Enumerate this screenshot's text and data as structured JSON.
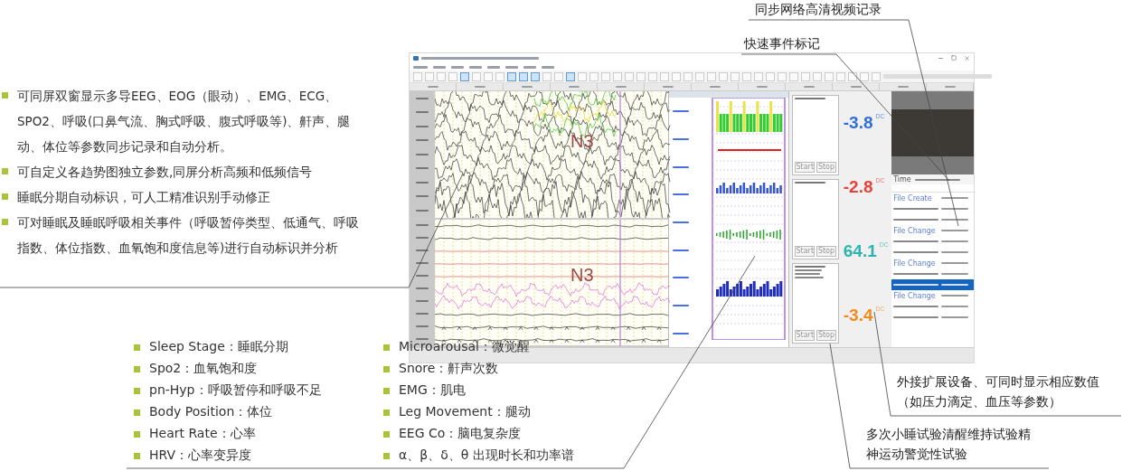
{
  "intro_notes": [
    "可同屏双窗显示多导EEG、EOG（眼动）、EMG、ECG、SPO2、呼吸(口鼻气流、胸式呼吸、腹式呼吸等)、鼾声、腿动、体位等参数同步记录和自动分析。",
    "可自定义各趋势图独立参数,同屏分析高频和低频信号",
    "睡眠分期自动标识，可人工精准识别手动修正",
    "可对睡眠及睡眠呼吸相关事件（呼吸暂停类型、低通气、呼吸指数、体位指数、血氧饱和度信息等)进行自动标识并分析"
  ],
  "software_window": {
    "stage_labels": [
      "N3",
      "N3"
    ],
    "event_boxes": [
      {
        "buttons": [
          "Start",
          "Stop"
        ]
      },
      {
        "buttons": [
          "Start",
          "Stop"
        ]
      },
      {
        "buttons": [
          "Start",
          "Stop"
        ]
      }
    ],
    "readings": [
      {
        "value": "-3.8",
        "unit": "DC",
        "color": "#2f6fd6"
      },
      {
        "value": "-2.8",
        "unit": "DC",
        "color": "#e8413c"
      },
      {
        "value": "64.1",
        "unit": "DC",
        "color": "#2bb5b0"
      },
      {
        "value": "-3.4",
        "unit": "DC",
        "color": "#f28a1e"
      }
    ],
    "video_panel": {
      "time_label": "Time"
    },
    "event_list": {
      "rows": [
        {
          "kind": "file",
          "label": "File Create",
          "selected": false
        },
        {
          "kind": "other",
          "selected": false
        },
        {
          "kind": "other",
          "selected": false
        },
        {
          "kind": "file",
          "label": "File Change",
          "selected": false
        },
        {
          "kind": "other",
          "selected": false
        },
        {
          "kind": "other",
          "selected": false
        },
        {
          "kind": "file",
          "label": "File Change",
          "selected": false
        },
        {
          "kind": "other",
          "selected": false
        },
        {
          "kind": "other",
          "selected": true
        },
        {
          "kind": "file",
          "label": "File Change",
          "selected": false
        },
        {
          "kind": "other",
          "selected": false
        },
        {
          "kind": "other",
          "selected": false
        }
      ]
    }
  },
  "feature_legend": {
    "columns": [
      [
        "Sleep Stage：睡眠分期",
        "Spo2：血氧饱和度",
        "pn-Hyp：呼吸暂停和呼吸不足",
        "Body Position：体位",
        "Heart Rate：心率",
        "HRV：心率变异度"
      ],
      [
        "Microarousal：微觉醒",
        "Snore：鼾声次数",
        "EMG：肌电",
        "Leg Movement：腿动",
        "EEG Co：脑电复杂度",
        "α、β、δ、θ 出现时长和功率谱"
      ]
    ]
  },
  "callouts": [
    {
      "text": "同步网络高清视频记录"
    },
    {
      "text": "快速事件标记"
    },
    {
      "text": "外接扩展设备、可同时显示相应数值（如压力滴定、血压等参数）"
    },
    {
      "text": "多次小睡试验清醒维持试验精神运动警觉性试验"
    }
  ]
}
